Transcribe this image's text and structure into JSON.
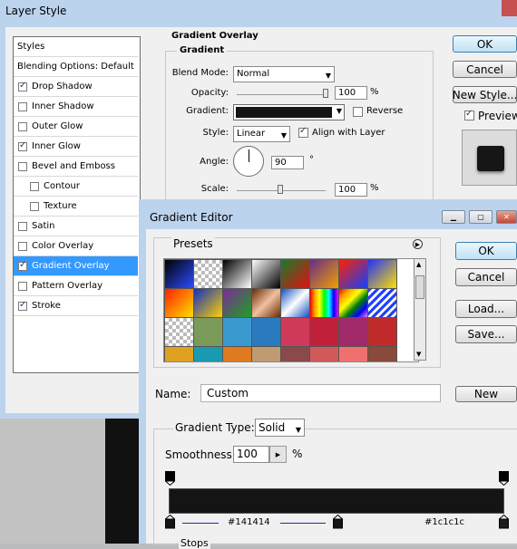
{
  "layer_style": {
    "title": "Layer Style",
    "categories_header": "Styles",
    "categories": [
      {
        "label": "Blending Options: Default",
        "checkbox": false,
        "checked": false,
        "selected": false,
        "indent": false
      },
      {
        "label": "Drop Shadow",
        "checkbox": true,
        "checked": true,
        "selected": false,
        "indent": false
      },
      {
        "label": "Inner Shadow",
        "checkbox": true,
        "checked": false,
        "selected": false,
        "indent": false
      },
      {
        "label": "Outer Glow",
        "checkbox": true,
        "checked": false,
        "selected": false,
        "indent": false
      },
      {
        "label": "Inner Glow",
        "checkbox": true,
        "checked": true,
        "selected": false,
        "indent": false
      },
      {
        "label": "Bevel and Emboss",
        "checkbox": true,
        "checked": false,
        "selected": false,
        "indent": false
      },
      {
        "label": "Contour",
        "checkbox": true,
        "checked": false,
        "selected": false,
        "indent": true
      },
      {
        "label": "Texture",
        "checkbox": true,
        "checked": false,
        "selected": false,
        "indent": true
      },
      {
        "label": "Satin",
        "checkbox": true,
        "checked": false,
        "selected": false,
        "indent": false
      },
      {
        "label": "Color Overlay",
        "checkbox": true,
        "checked": false,
        "selected": false,
        "indent": false
      },
      {
        "label": "Gradient Overlay",
        "checkbox": true,
        "checked": true,
        "selected": true,
        "indent": false
      },
      {
        "label": "Pattern Overlay",
        "checkbox": true,
        "checked": false,
        "selected": false,
        "indent": false
      },
      {
        "label": "Stroke",
        "checkbox": true,
        "checked": true,
        "selected": false,
        "indent": false
      }
    ],
    "section_title": "Gradient Overlay",
    "group_title": "Gradient",
    "blend_mode_label": "Blend Mode:",
    "blend_mode_value": "Normal",
    "opacity_label": "Opacity:",
    "opacity_value": "100",
    "opacity_unit": "%",
    "opacity_level": 1.0,
    "gradient_label": "Gradient:",
    "reverse_label": "Reverse",
    "style_label": "Style:",
    "style_value": "Linear",
    "align_label": "Align with Layer",
    "angle_label": "Angle:",
    "angle_value": "90",
    "angle_unit": "°",
    "scale_label": "Scale:",
    "scale_value": "100",
    "scale_unit": "%",
    "scale_level": 0.5,
    "ok_label": "OK",
    "cancel_label": "Cancel",
    "new_style_label": "New Style...",
    "preview_label": "Preview"
  },
  "gradient_editor": {
    "title": "Gradient Editor",
    "presets_label": "Presets",
    "ok_label": "OK",
    "cancel_label": "Cancel",
    "load_label": "Load...",
    "save_label": "Save...",
    "name_label": "Name:",
    "name_value": "Custom",
    "new_label": "New",
    "gradient_type_label": "Gradient Type:",
    "gradient_type_value": "Solid",
    "smoothness_label": "Smoothness:",
    "smoothness_value": "100",
    "smoothness_unit": "%",
    "stop_left_color": "#141414",
    "stop_right_color": "#1c1c1c",
    "stops_label": "Stops"
  },
  "colors": {
    "selection": "#3399ff",
    "gradient_fill": "#141414",
    "default_button": "#bfe2f5"
  }
}
